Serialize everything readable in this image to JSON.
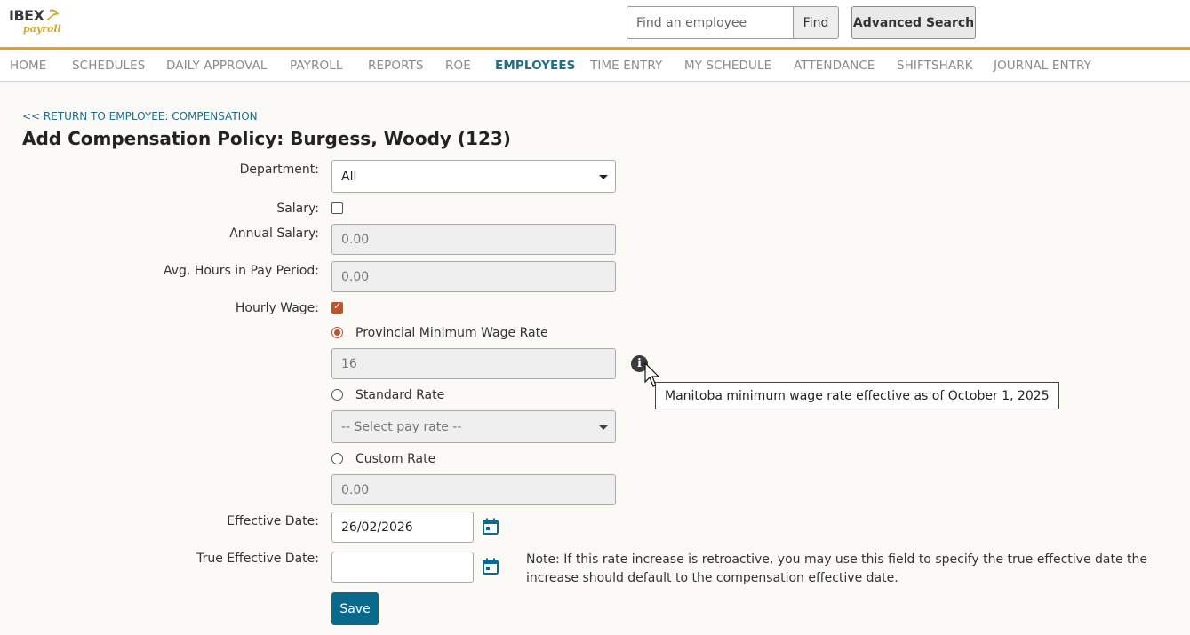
{
  "header": {
    "logo_text": "IBEX",
    "logo_subtext": "payroll",
    "search": {
      "placeholder": "Find an employee",
      "value": ""
    },
    "find_label": "Find",
    "advanced_search_label": "Advanced Search"
  },
  "nav": {
    "items": [
      {
        "label": "HOME",
        "active": false
      },
      {
        "label": "SCHEDULES",
        "active": false
      },
      {
        "label": "DAILY APPROVAL",
        "active": false
      },
      {
        "label": "PAYROLL",
        "active": false
      },
      {
        "label": "REPORTS",
        "active": false
      },
      {
        "label": "ROE",
        "active": false
      },
      {
        "label": "EMPLOYEES",
        "active": true
      },
      {
        "label": "TIME ENTRY",
        "active": false
      },
      {
        "label": "MY SCHEDULE",
        "active": false
      },
      {
        "label": "ATTENDANCE",
        "active": false
      },
      {
        "label": "SHIFTSHARK",
        "active": false
      },
      {
        "label": "JOURNAL ENTRY",
        "active": false
      }
    ]
  },
  "page": {
    "return_link": "<< RETURN TO EMPLOYEE: COMPENSATION",
    "title": "Add Compensation Policy: Burgess, Woody (123)"
  },
  "form": {
    "department": {
      "label": "Department:",
      "value": "All"
    },
    "salary": {
      "label": "Salary:",
      "checked": false
    },
    "annual_salary": {
      "label": "Annual Salary:",
      "value": "0.00"
    },
    "avg_hours": {
      "label": "Avg. Hours in Pay Period:",
      "value": "0.00"
    },
    "hourly_wage": {
      "label": "Hourly Wage:",
      "checked": true
    },
    "provincial_min": {
      "label": "Provincial Minimum Wage Rate",
      "selected": true,
      "value": "16"
    },
    "tooltip": "Manitoba minimum wage rate effective as of  October 1, 2025",
    "standard_rate": {
      "label": "Standard Rate",
      "selected": false,
      "placeholder": "-- Select pay rate --"
    },
    "custom_rate": {
      "label": "Custom Rate",
      "selected": false,
      "value": "0.00"
    },
    "effective_date": {
      "label": "Effective Date:",
      "value": "26/02/2026"
    },
    "true_effective_date": {
      "label": "True Effective Date:",
      "value": ""
    },
    "note": "Note: If this rate increase is retroactive, you may use this field to specify the true effective date the increase should default to the compensation effective date.",
    "save_label": "Save"
  },
  "colors": {
    "accent_gold": "#d4a72c",
    "link_blue": "#1f6f8b",
    "save_button": "#0b6a8c",
    "check_orange": "#c1532a"
  }
}
